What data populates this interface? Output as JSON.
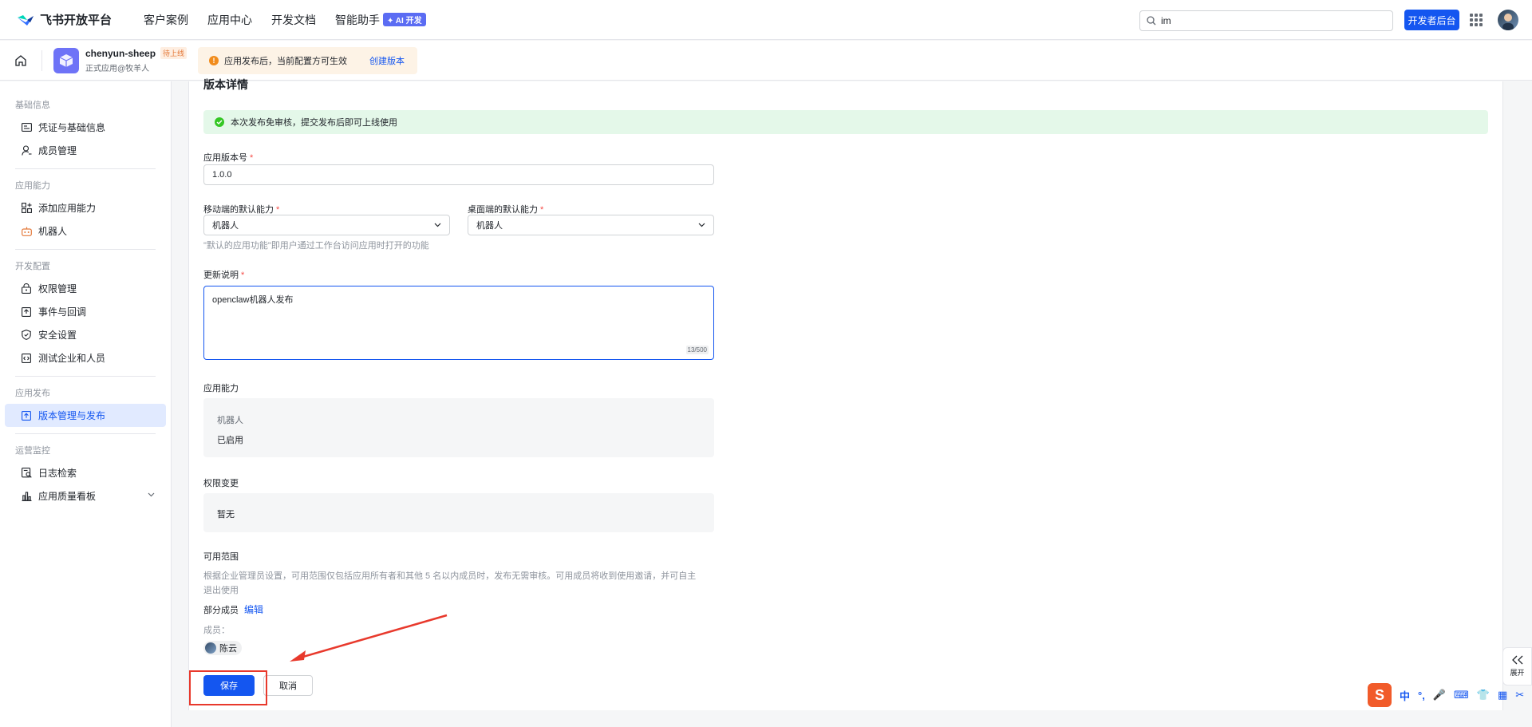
{
  "topnav": {
    "logo_text": "飞书开放平台",
    "links": [
      "客户案例",
      "应用中心",
      "开发文档",
      "智能助手"
    ],
    "ai_badge": "✦ AI 开发",
    "search_value": "im",
    "dev_button": "开发者后台"
  },
  "app": {
    "name": "chenyun-sheep",
    "badge": "待上线",
    "subtitle": "正式应用@牧羊人",
    "notice_text": "应用发布后，当前配置方可生效",
    "notice_link": "创建版本"
  },
  "sidebar": {
    "groups": [
      {
        "title": "基础信息",
        "items": [
          "凭证与基础信息",
          "成员管理"
        ]
      },
      {
        "title": "应用能力",
        "items": [
          "添加应用能力",
          "机器人"
        ]
      },
      {
        "title": "开发配置",
        "items": [
          "权限管理",
          "事件与回调",
          "安全设置",
          "测试企业和人员"
        ]
      },
      {
        "title": "应用发布",
        "items": [
          "版本管理与发布"
        ]
      },
      {
        "title": "运营监控",
        "items": [
          "日志检索",
          "应用质量看板"
        ]
      }
    ]
  },
  "form": {
    "section_title": "版本详情",
    "success_text": "本次发布免审核，提交发布后即可上线使用",
    "version_label": "应用版本号",
    "version_value": "1.0.0",
    "mobile_label": "移动端的默认能力",
    "mobile_value": "机器人",
    "desktop_label": "桌面端的默认能力",
    "desktop_value": "机器人",
    "default_hint": "\"默认的应用功能\"即用户通过工作台访问应用时打开的功能",
    "notes_label": "更新说明",
    "notes_value": "openclaw机器人发布",
    "notes_counter": "13/500",
    "capability_label": "应用能力",
    "capability_name": "机器人",
    "capability_status": "已启用",
    "permission_label": "权限变更",
    "permission_value": "暂无",
    "scope_label": "可用范围",
    "scope_hint_line1": "根据企业管理员设置，可用范围仅包括应用所有者和其他 5 名以内成员时，发布无需审核。可用成员将收到使用邀请，并可自主",
    "scope_hint_line2": "退出使用",
    "scope_type": "部分成员",
    "scope_edit": "编辑",
    "members_label": "成员：",
    "member_name": "陈云",
    "save": "保存",
    "cancel": "取消"
  },
  "expand_label": "展开",
  "ime": {
    "logo": "S",
    "items": [
      "中",
      "°,",
      "🎤",
      "⌨",
      "👕",
      "▦",
      "✂"
    ]
  }
}
